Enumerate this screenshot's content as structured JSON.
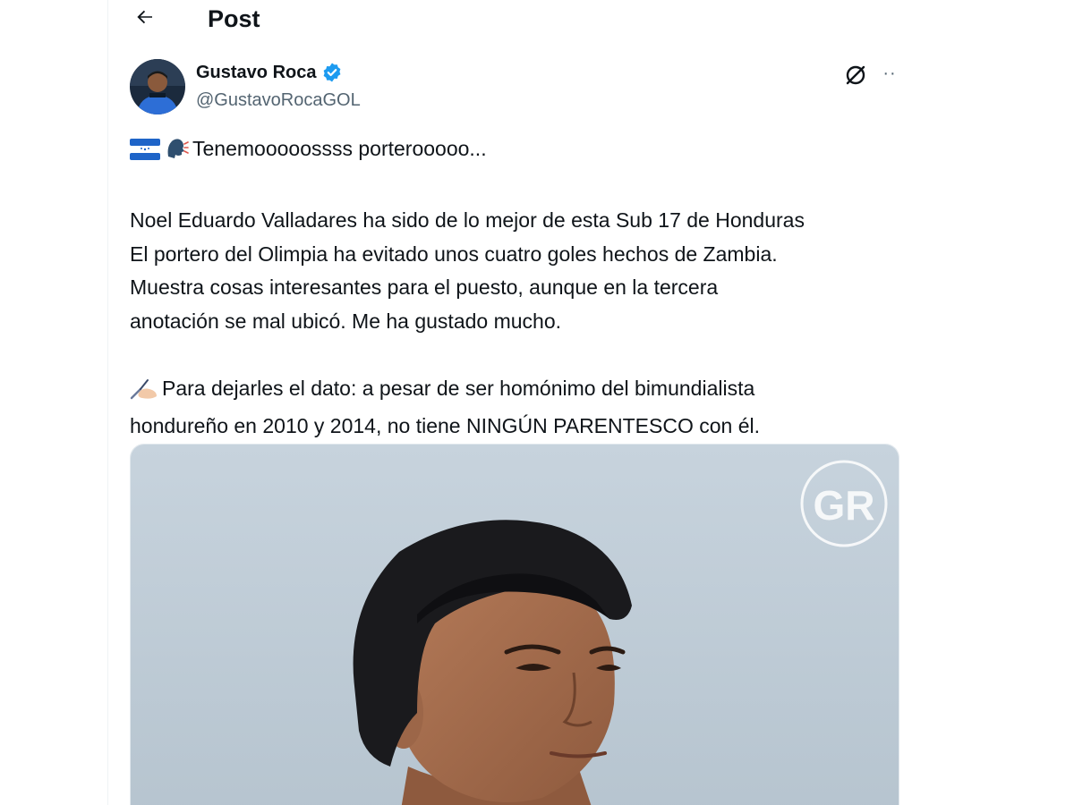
{
  "header": {
    "back_icon": "arrow-left-icon",
    "title": "Post"
  },
  "author": {
    "name": "Gustavo Roca",
    "handle": "@GustavoRocaGOL",
    "verified_icon": "verified-badge-icon",
    "verified_color": "#1d9bf0"
  },
  "actions": {
    "grok_icon": "grok-icon",
    "more_icon": "more-horizontal-icon",
    "more_label": "··"
  },
  "tweet": {
    "line1": "Tenemooooossss porterooooo...",
    "paragraph2": [
      "Noel Eduardo Valladares ha sido de lo mejor de esta Sub 17 de Honduras",
      "El portero del Olimpia ha evitado unos cuatro goles hechos de Zambia.",
      "Muestra cosas interesantes para el puesto, aunque en la tercera",
      "anotación se mal ubicó. Me ha gustado mucho."
    ],
    "paragraph3": [
      "Para dejarles el dato: a pesar de ser homónimo del bimundialista",
      "hondureño en 2010 y 2014, no tiene NINGÚN PARENTESCO con él."
    ],
    "emojis": [
      "honduras-flag-icon",
      "speaking-head-icon",
      "writing-hand-icon"
    ]
  },
  "media": {
    "watermark": "GR",
    "description_icon": "photo-goalkeeper-portrait"
  }
}
